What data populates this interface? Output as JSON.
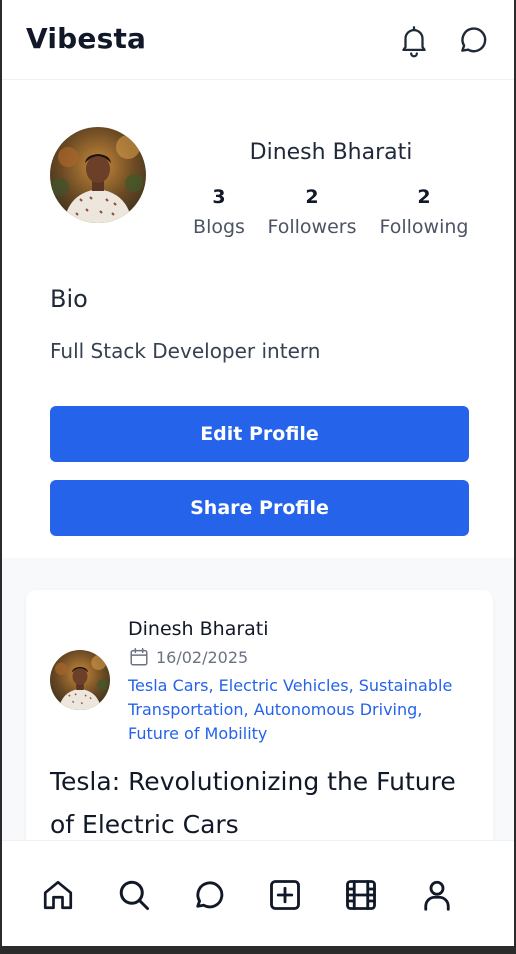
{
  "app": {
    "brand": "Vibesta"
  },
  "header": {
    "icons": [
      "bell-icon",
      "chat-bubble-icon"
    ]
  },
  "profile": {
    "name": "Dinesh Bharati",
    "stats": [
      {
        "value": "3",
        "label": "Blogs"
      },
      {
        "value": "2",
        "label": "Followers"
      },
      {
        "value": "2",
        "label": "Following"
      }
    ],
    "bio_heading": "Bio",
    "bio_text": "Full Stack Developer intern",
    "edit_button": "Edit Profile",
    "share_button": "Share Profile"
  },
  "post": {
    "author": "Dinesh Bharati",
    "date": "16/02/2025",
    "tags": "Tesla Cars, Electric Vehicles, Sustainable Transportation, Autonomous Driving, Future of Mobility",
    "title": "Tesla: Revolutionizing the Future of Electric Cars"
  },
  "bottom_nav": {
    "items": [
      "home-icon",
      "search-icon",
      "chat-bubble-icon",
      "add-square-icon",
      "film-icon",
      "user-icon"
    ]
  },
  "colors": {
    "accent": "#2563eb",
    "text_dark": "#111827",
    "text_muted": "#4b5563",
    "background": "#f8f9fb"
  }
}
